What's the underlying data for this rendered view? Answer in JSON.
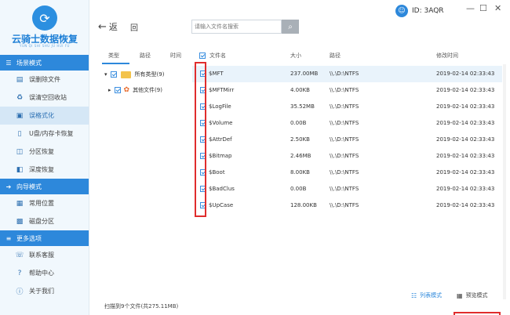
{
  "app": {
    "name": "云骑士数据恢复",
    "subtitle": "YUN QI SHI SHU JU HUI FU",
    "id_label": "ID: 3AQR"
  },
  "sidebar": {
    "sections": [
      {
        "title": "场景模式",
        "items": [
          "误删除文件",
          "误清空回收站",
          "误格式化",
          "U盘/内存卡恢复",
          "分区恢复",
          "深度恢复"
        ]
      },
      {
        "title": "向导模式",
        "items": [
          "常用位置",
          "磁盘分区"
        ]
      },
      {
        "title": "更多选项",
        "items": [
          "联系客服",
          "帮助中心",
          "关于我们"
        ]
      }
    ]
  },
  "toolbar": {
    "back_label": "返",
    "back2_label": "回",
    "search_placeholder": "请输入文件名搜索"
  },
  "tree": {
    "headers": [
      "类型",
      "路径",
      "时间"
    ],
    "rows": [
      {
        "label": "所有类型(9)"
      },
      {
        "label": "其他文件(9)"
      }
    ]
  },
  "table": {
    "headers": [
      "文件名",
      "大小",
      "路径",
      "修改时间"
    ],
    "rows": [
      {
        "name": "$MFT",
        "size": "237.00MB",
        "path": "\\\\.\\D:\\NTFS",
        "time": "2019-02-14 02:33:43"
      },
      {
        "name": "$MFTMirr",
        "size": "4.00KB",
        "path": "\\\\.\\D:\\NTFS",
        "time": "2019-02-14 02:33:43"
      },
      {
        "name": "$LogFile",
        "size": "35.52MB",
        "path": "\\\\.\\D:\\NTFS",
        "time": "2019-02-14 02:33:43"
      },
      {
        "name": "$Volume",
        "size": "0.00B",
        "path": "\\\\.\\D:\\NTFS",
        "time": "2019-02-14 02:33:43"
      },
      {
        "name": "$AttrDef",
        "size": "2.50KB",
        "path": "\\\\.\\D:\\NTFS",
        "time": "2019-02-14 02:33:43"
      },
      {
        "name": "$Bitmap",
        "size": "2.46MB",
        "path": "\\\\.\\D:\\NTFS",
        "time": "2019-02-14 02:33:43"
      },
      {
        "name": "$Boot",
        "size": "8.00KB",
        "path": "\\\\.\\D:\\NTFS",
        "time": "2019-02-14 02:33:43"
      },
      {
        "name": "$BadClus",
        "size": "0.00B",
        "path": "\\\\.\\D:\\NTFS",
        "time": "2019-02-14 02:33:43"
      },
      {
        "name": "$UpCase",
        "size": "128.00KB",
        "path": "\\\\.\\D:\\NTFS",
        "time": "2019-02-14 02:33:43"
      }
    ]
  },
  "status": {
    "scan_summary": "扫描到9个文件(共275.11MB)"
  },
  "view_modes": {
    "list": "列表模式",
    "preview": "预览模式"
  },
  "colors": {
    "accent": "#2d88db",
    "highlight_box": "#e02d2d"
  }
}
